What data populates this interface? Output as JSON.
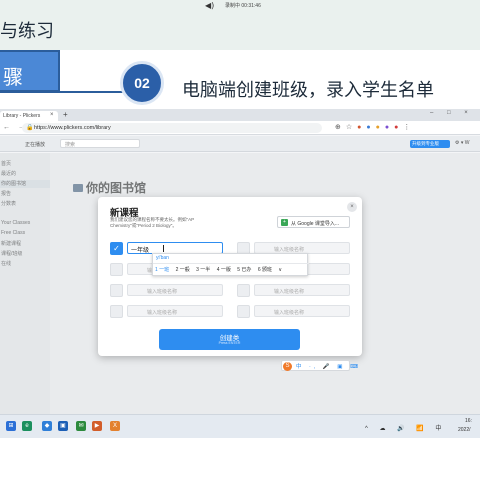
{
  "slide": {
    "top_title": "与练习",
    "recording_text": "录制中 00:31:46",
    "step_label": "骤",
    "step_number": "02",
    "step_title": "电脑端创建班级，录入学生名单"
  },
  "browser": {
    "tab_title": "Library - Plickers",
    "tab_close": "×",
    "new_tab": "+",
    "window_controls": "– □ ×",
    "nav": "← → ↻",
    "url": "https://www.plickers.com/library",
    "lock": "🔒"
  },
  "app": {
    "current_class": "正在播放",
    "search_placeholder": "搜索",
    "upgrade_label": "升级到专业版",
    "user_menu": "⚙ ▾ W",
    "library_title": "你的图书馆",
    "sidebar_items": [
      "首页",
      "最近的",
      "你的图书馆",
      "报告",
      "分数表",
      "",
      "Your Classes",
      "Free Class",
      "新建课程",
      "课程/班级",
      "在线",
      ""
    ]
  },
  "modal": {
    "title": "新课程",
    "hint": "我们建议您的课程名称不要太长。例如\"AP Chemistry\"或\"Period 2 Biology\"。",
    "google_icon": "+",
    "google_label": "从 Google 课堂导入...",
    "close": "×",
    "check_mark": "✓",
    "active_value": "一年级",
    "field_placeholder": "输入班级名称",
    "create_label": "创建类",
    "create_sub": "Press ENTER"
  },
  "ime": {
    "pinyin": "yi'ban",
    "candidates": [
      "1 一班",
      "2 一般",
      "3 一半",
      "4 一版",
      "5 已办",
      "6 颁班"
    ],
    "more": "∨",
    "logo": "S",
    "tools": "中 ·, 🎤 ▣ ⌨"
  },
  "taskbar": {
    "icons": [
      "⊞",
      "e",
      "◆",
      "▣",
      "✉",
      "▶",
      "X"
    ],
    "tray": "^ ☁ 🔊 📶 中",
    "time": "16:",
    "date": "2022/"
  }
}
